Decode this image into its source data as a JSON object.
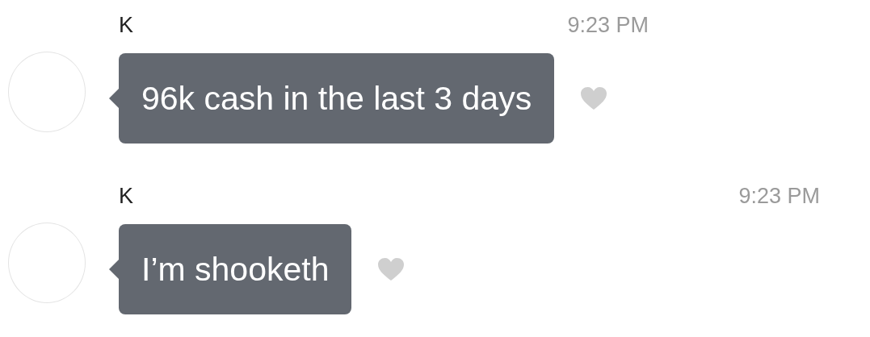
{
  "messages": [
    {
      "sender": "K",
      "time": "9:23 PM",
      "text": "96k cash in the last 3 days",
      "liked": false
    },
    {
      "sender": "K",
      "time": "9:23 PM",
      "text": "I’m shooketh",
      "liked": false
    }
  ]
}
